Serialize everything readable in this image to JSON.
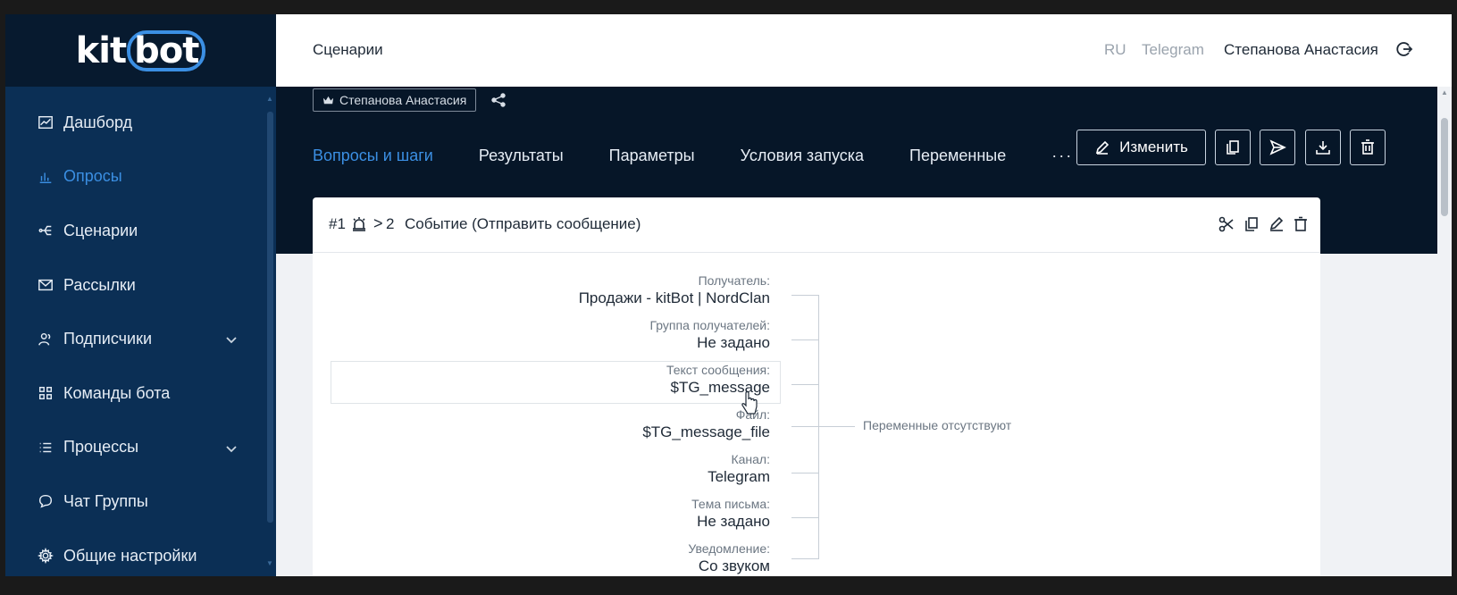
{
  "brand": {
    "logo_kit": "kit",
    "logo_bot": "bot",
    "accent": "#3b8fe3",
    "sidebar_bg": "#0b2f55",
    "header_bg": "#061628"
  },
  "sidebar": {
    "items": [
      {
        "label": "Дашборд",
        "icon": "chart-line-icon"
      },
      {
        "label": "Опросы",
        "icon": "bar-chart-icon",
        "active": true
      },
      {
        "label": "Сценарии",
        "icon": "branch-icon"
      },
      {
        "label": "Рассылки",
        "icon": "mail-icon"
      },
      {
        "label": "Подписчики",
        "icon": "users-icon",
        "expandable": true
      },
      {
        "label": "Команды бота",
        "icon": "grid-icon"
      },
      {
        "label": "Процессы",
        "icon": "list-icon",
        "expandable": true
      },
      {
        "label": "Чат Группы",
        "icon": "chat-icon"
      },
      {
        "label": "Общие настройки",
        "icon": "gear-icon"
      }
    ]
  },
  "topbar": {
    "title": "Сценарии",
    "lang": "RU",
    "channel": "Telegram",
    "user": "Степанова Анастасия"
  },
  "header": {
    "owner": "Степанова Анастасия",
    "tabs": [
      "Вопросы и шаги",
      "Результаты",
      "Параметры",
      "Условия запуска",
      "Переменные",
      "···"
    ],
    "edit_label": "Изменить"
  },
  "card": {
    "num": "#1",
    "arrow": ">",
    "next": "2",
    "event": "Событие (Отправить сообщение)",
    "fields": [
      {
        "label": "Получатель:",
        "value": "Продажи - kitBot | NordClan"
      },
      {
        "label": "Группа получателей:",
        "value": "Не задано"
      },
      {
        "label": "Текст сообщения:",
        "value": "$TG_message"
      },
      {
        "label": "Файл:",
        "value": "$TG_message_file"
      },
      {
        "label": "Канал:",
        "value": "Telegram"
      },
      {
        "label": "Тема письма:",
        "value": "Не задано"
      },
      {
        "label": "Уведомление:",
        "value": "Со звуком"
      }
    ],
    "vars_note": "Переменные отсутствуют"
  }
}
